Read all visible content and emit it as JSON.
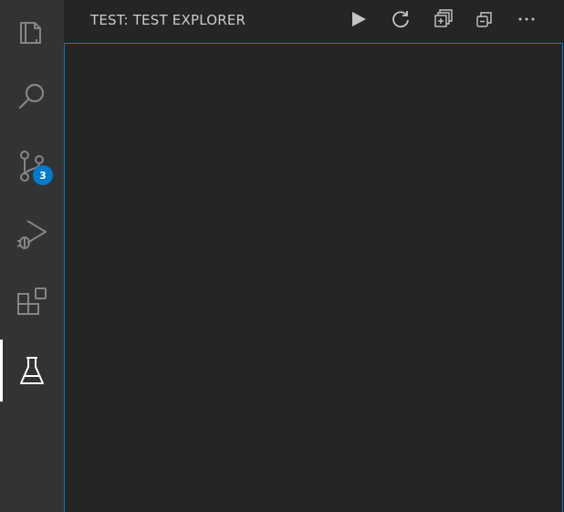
{
  "activity_bar": {
    "items": [
      {
        "name": "explorer",
        "icon": "files-icon"
      },
      {
        "name": "search",
        "icon": "search-icon"
      },
      {
        "name": "source-control",
        "icon": "source-control-icon",
        "badge": "3"
      },
      {
        "name": "run-and-debug",
        "icon": "run-debug-icon"
      },
      {
        "name": "extensions",
        "icon": "extensions-icon"
      },
      {
        "name": "testing",
        "icon": "beaker-icon",
        "active": true
      }
    ]
  },
  "sidebar": {
    "title": "TEST: TEST EXPLORER",
    "actions": [
      {
        "name": "run-all-tests",
        "icon": "play-icon"
      },
      {
        "name": "refresh-tests",
        "icon": "refresh-icon"
      },
      {
        "name": "expand-all",
        "icon": "expand-all-icon"
      },
      {
        "name": "collapse-all",
        "icon": "collapse-all-icon"
      },
      {
        "name": "more-actions",
        "icon": "ellipsis-icon"
      }
    ]
  },
  "colors": {
    "activity_bar_bg": "#333333",
    "sidebar_bg": "#252526",
    "focus_border": "#007acc",
    "badge_bg": "#007acc",
    "icon_inactive": "#858585",
    "icon_active": "#ffffff",
    "header_fg": "#cccccc"
  }
}
